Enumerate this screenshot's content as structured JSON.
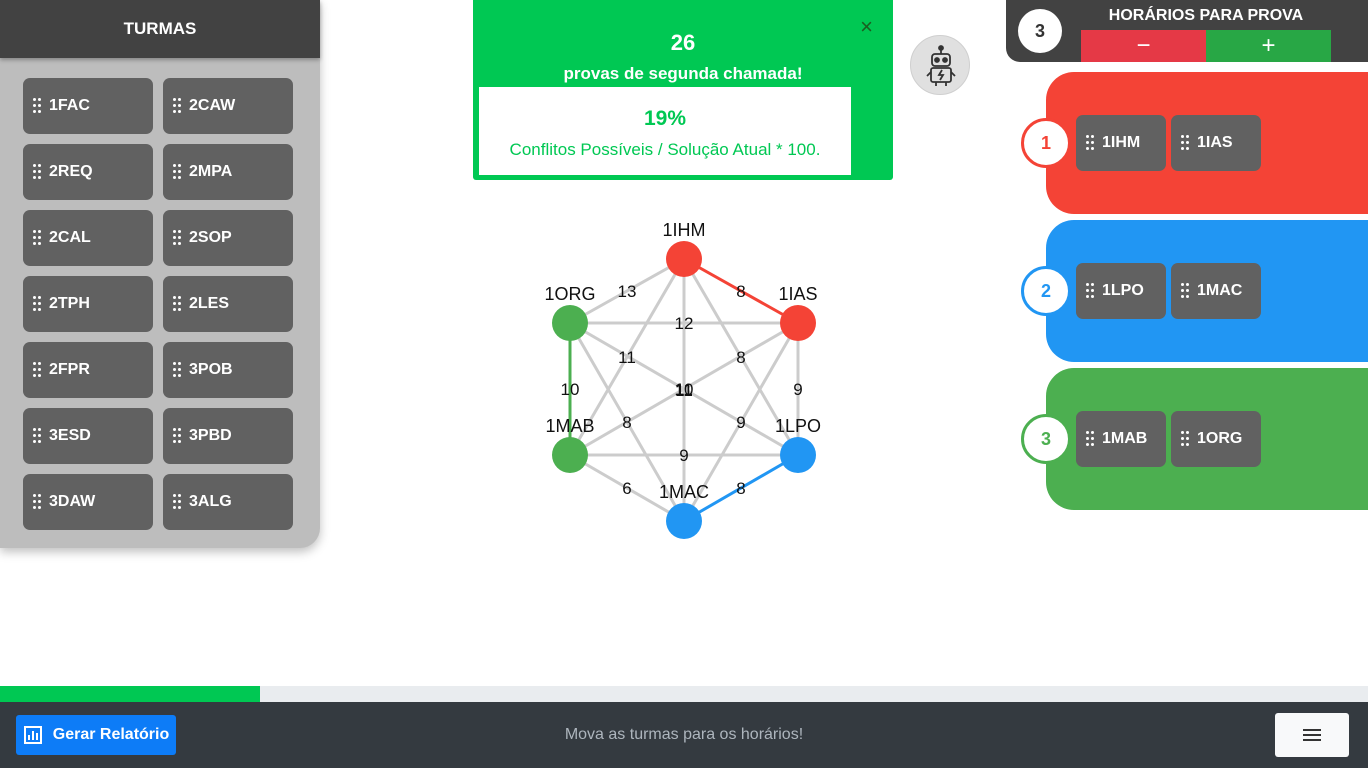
{
  "sidebar": {
    "title": "TURMAS",
    "turmas": [
      "1FAC",
      "2CAW",
      "2REQ",
      "2MPA",
      "2CAL",
      "2SOP",
      "2TPH",
      "2LES",
      "2FPR",
      "3POB",
      "3ESD",
      "3PBD",
      "3DAW",
      "3ALG"
    ]
  },
  "alert": {
    "count": "26",
    "subtitle": "provas de segunda chamada!",
    "close": "×",
    "percent": "19%",
    "percent_desc": "Conflitos Possíveis / Solução Atual * 100."
  },
  "robot": {
    "icon": "robot-icon"
  },
  "horarios": {
    "count": "3",
    "title": "HORÁRIOS PARA PROVA",
    "minus": "−",
    "plus": "+"
  },
  "slots": [
    {
      "number": "1",
      "color": "#f44336",
      "turmas": [
        "1IHM",
        "1IAS"
      ]
    },
    {
      "number": "2",
      "color": "#2196f3",
      "turmas": [
        "1LPO",
        "1MAC"
      ]
    },
    {
      "number": "3",
      "color": "#4caf50",
      "turmas": [
        "1MAB",
        "1ORG"
      ]
    }
  ],
  "graph": {
    "nodes": [
      {
        "id": "1IHM",
        "color": "#f44336"
      },
      {
        "id": "1IAS",
        "color": "#f44336"
      },
      {
        "id": "1ORG",
        "color": "#4caf50"
      },
      {
        "id": "1MAB",
        "color": "#4caf50"
      },
      {
        "id": "1LPO",
        "color": "#2196f3"
      },
      {
        "id": "1MAC",
        "color": "#2196f3"
      }
    ],
    "edges": [
      {
        "from": "1IHM",
        "to": "1IAS",
        "weight": "8",
        "color": "#f44336"
      },
      {
        "from": "1IHM",
        "to": "1ORG",
        "weight": "13",
        "color": "#cccccc"
      },
      {
        "from": "1ORG",
        "to": "1IAS",
        "weight": "12",
        "color": "#cccccc"
      },
      {
        "from": "1ORG",
        "to": "1MAB",
        "weight": "10",
        "color": "#4caf50"
      },
      {
        "from": "1IAS",
        "to": "1LPO",
        "weight": "9",
        "color": "#cccccc"
      },
      {
        "from": "1MAB",
        "to": "1LPO",
        "weight": "9",
        "color": "#cccccc"
      },
      {
        "from": "1MAB",
        "to": "1MAC",
        "weight": "6",
        "color": "#cccccc"
      },
      {
        "from": "1LPO",
        "to": "1MAC",
        "weight": "8",
        "color": "#2196f3"
      },
      {
        "from": "1IHM",
        "to": "1MAB",
        "weight": "11",
        "color": "#cccccc"
      },
      {
        "from": "1IHM",
        "to": "1LPO",
        "weight": "8",
        "color": "#cccccc"
      },
      {
        "from": "1ORG",
        "to": "1MAC",
        "weight": "8",
        "color": "#cccccc"
      },
      {
        "from": "1IAS",
        "to": "1MAC",
        "weight": "9",
        "color": "#cccccc"
      },
      {
        "from": "1IHM",
        "to": "1MAC",
        "weight": "11",
        "color": "#cccccc"
      },
      {
        "from": "1ORG",
        "to": "1LPO",
        "weight": "10",
        "color": "#cccccc"
      },
      {
        "from": "1IAS",
        "to": "1MAB",
        "weight": "11",
        "color": "#cccccc"
      }
    ]
  },
  "progress": {
    "value": 0.19,
    "color": "#00c853"
  },
  "footer": {
    "report_label": "Gerar Relatório",
    "message": "Mova as turmas para os horários!",
    "menu_icon": "hamburger-menu-icon"
  }
}
